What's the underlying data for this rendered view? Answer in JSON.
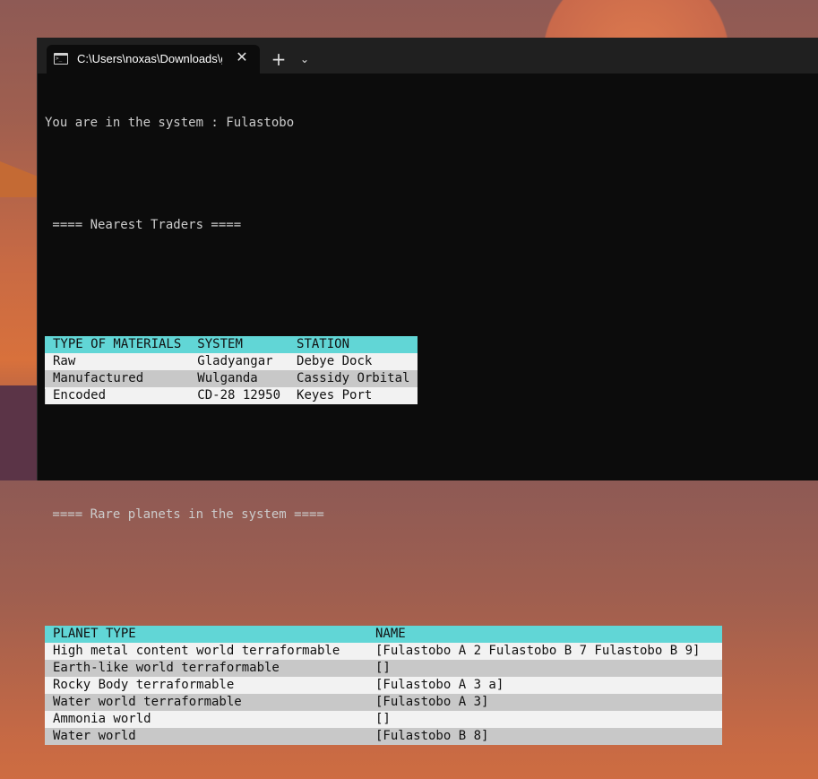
{
  "window": {
    "tab_title": "C:\\Users\\noxas\\Downloads\\gc",
    "close_glyph": "✕",
    "new_tab_glyph": "+",
    "dropdown_glyph": "⌄"
  },
  "terminal": {
    "system_line": "You are in the system : Fulastobo",
    "traders_heading": " ==== Nearest Traders ====",
    "rare_heading": " ==== Rare planets in the system ===="
  },
  "traders_table": {
    "headers": [
      "TYPE OF MATERIALS",
      "SYSTEM",
      "STATION"
    ],
    "rows": [
      [
        "Raw",
        "Gladyangar",
        "Debye Dock"
      ],
      [
        "Manufactured",
        "Wulganda",
        "Cassidy Orbital"
      ],
      [
        "Encoded",
        "CD-28 12950",
        "Keyes Port"
      ]
    ]
  },
  "planets_table": {
    "headers": [
      "PLANET TYPE",
      "NAME"
    ],
    "rows": [
      [
        "High metal content world terraformable",
        "[Fulastobo A 2 Fulastobo B 7 Fulastobo B 9]"
      ],
      [
        "Earth-like world terraformable",
        "[]"
      ],
      [
        "Rocky Body terraformable",
        "[Fulastobo A 3 a]"
      ],
      [
        "Water world terraformable",
        "[Fulastobo A 3]"
      ],
      [
        "Ammonia world",
        "[]"
      ],
      [
        "Water world",
        "[Fulastobo B 8]"
      ]
    ]
  },
  "colors": {
    "header_bg": "#61d6d6",
    "row_light": "#f2f2f2",
    "row_dark": "#c8c8c8",
    "terminal_bg": "#0c0c0c"
  }
}
